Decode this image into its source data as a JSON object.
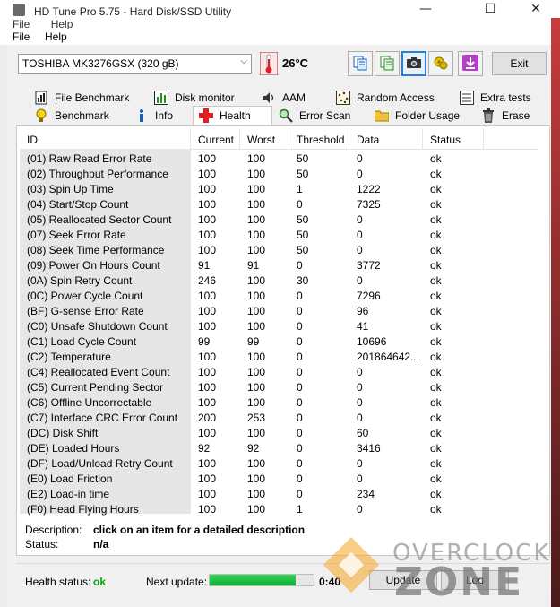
{
  "window": {
    "title": "HD Tune Pro 5.75 - Hard Disk/SSD Utility",
    "minimize": "—",
    "maximize": "☐",
    "close": "✕"
  },
  "ghost_menu": [
    "File",
    "Help"
  ],
  "menu": [
    {
      "label": "File"
    },
    {
      "label": "Help"
    }
  ],
  "toolbar": {
    "drive": "TOSHIBA MK3276GSX (320 gB)",
    "temperature": "26°C",
    "exit_label": "Exit",
    "icons": [
      "copy-icon",
      "copy-all-icon",
      "camera-icon",
      "options-icon",
      "save-icon"
    ]
  },
  "tabs_row1": [
    {
      "label": "File Benchmark",
      "icon": "file-benchmark-icon"
    },
    {
      "label": "Disk monitor",
      "icon": "disk-monitor-icon"
    },
    {
      "label": "AAM",
      "icon": "speaker-icon"
    },
    {
      "label": "Random Access",
      "icon": "random-access-icon"
    },
    {
      "label": "Extra tests",
      "icon": "extra-tests-icon"
    }
  ],
  "tabs_row2": [
    {
      "label": "Benchmark",
      "icon": "benchmark-icon"
    },
    {
      "label": "Info",
      "icon": "info-icon"
    },
    {
      "label": "Health",
      "icon": "health-cross-icon",
      "active": true
    },
    {
      "label": "Error Scan",
      "icon": "magnifier-icon"
    },
    {
      "label": "Folder Usage",
      "icon": "folder-icon"
    },
    {
      "label": "Erase",
      "icon": "trash-icon"
    }
  ],
  "table": {
    "columns": [
      "ID",
      "Current",
      "Worst",
      "Threshold",
      "Data",
      "Status"
    ],
    "rows": [
      [
        "(01) Raw Read Error Rate",
        "100",
        "100",
        "50",
        "0",
        "ok"
      ],
      [
        "(02) Throughput Performance",
        "100",
        "100",
        "50",
        "0",
        "ok"
      ],
      [
        "(03) Spin Up Time",
        "100",
        "100",
        "1",
        "1222",
        "ok"
      ],
      [
        "(04) Start/Stop Count",
        "100",
        "100",
        "0",
        "7325",
        "ok"
      ],
      [
        "(05) Reallocated Sector Count",
        "100",
        "100",
        "50",
        "0",
        "ok"
      ],
      [
        "(07) Seek Error Rate",
        "100",
        "100",
        "50",
        "0",
        "ok"
      ],
      [
        "(08) Seek Time Performance",
        "100",
        "100",
        "50",
        "0",
        "ok"
      ],
      [
        "(09) Power On Hours Count",
        "91",
        "91",
        "0",
        "3772",
        "ok"
      ],
      [
        "(0A) Spin Retry Count",
        "246",
        "100",
        "30",
        "0",
        "ok"
      ],
      [
        "(0C) Power Cycle Count",
        "100",
        "100",
        "0",
        "7296",
        "ok"
      ],
      [
        "(BF) G-sense Error Rate",
        "100",
        "100",
        "0",
        "96",
        "ok"
      ],
      [
        "(C0) Unsafe Shutdown Count",
        "100",
        "100",
        "0",
        "41",
        "ok"
      ],
      [
        "(C1) Load Cycle Count",
        "99",
        "99",
        "0",
        "10696",
        "ok"
      ],
      [
        "(C2) Temperature",
        "100",
        "100",
        "0",
        "201864642...",
        "ok"
      ],
      [
        "(C4) Reallocated Event Count",
        "100",
        "100",
        "0",
        "0",
        "ok"
      ],
      [
        "(C5) Current Pending Sector",
        "100",
        "100",
        "0",
        "0",
        "ok"
      ],
      [
        "(C6) Offline Uncorrectable",
        "100",
        "100",
        "0",
        "0",
        "ok"
      ],
      [
        "(C7) Interface CRC Error Count",
        "200",
        "253",
        "0",
        "0",
        "ok"
      ],
      [
        "(DC) Disk Shift",
        "100",
        "100",
        "0",
        "60",
        "ok"
      ],
      [
        "(DE) Loaded Hours",
        "92",
        "92",
        "0",
        "3416",
        "ok"
      ],
      [
        "(DF) Load/Unload Retry Count",
        "100",
        "100",
        "0",
        "0",
        "ok"
      ],
      [
        "(E0) Load Friction",
        "100",
        "100",
        "0",
        "0",
        "ok"
      ],
      [
        "(E2) Load-in time",
        "100",
        "100",
        "0",
        "234",
        "ok"
      ],
      [
        "(F0) Head Flying Hours",
        "100",
        "100",
        "1",
        "0",
        "ok"
      ]
    ]
  },
  "details": {
    "description_label": "Description:",
    "description_value": "click on an item for a detailed description",
    "status_label": "Status:",
    "status_value": "n/a"
  },
  "bottom": {
    "health_label": "Health status:",
    "health_value": "ok",
    "next_update_label": "Next update:",
    "progress_fraction": 0.83,
    "timer": "0:40",
    "update_label": "Update",
    "log_label": "Log"
  },
  "watermark": {
    "line1": "OVERCLOCK",
    "line2": "ZONE"
  },
  "colors": {
    "accent": "#2a7fd5",
    "ok_green": "#11a011",
    "progress_green": "#09b12f"
  }
}
